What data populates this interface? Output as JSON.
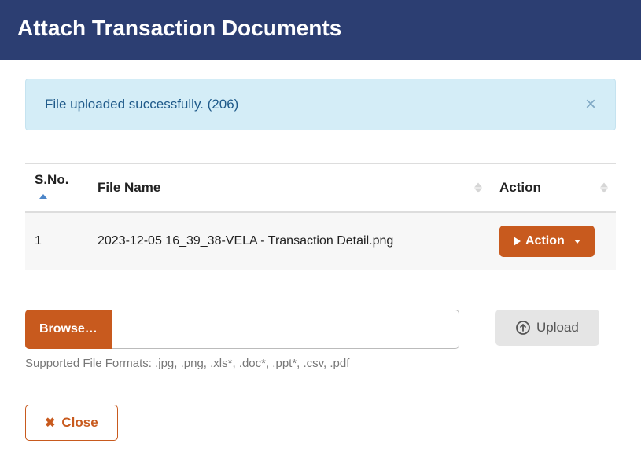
{
  "header": {
    "title": "Attach Transaction Documents"
  },
  "alert": {
    "message": "File uploaded successfully. (206)"
  },
  "table": {
    "headers": {
      "sno": "S.No.",
      "filename": "File Name",
      "action": "Action"
    },
    "rows": [
      {
        "sno": "1",
        "filename": "2023-12-05 16_39_38-VELA - Transaction Detail.png",
        "action_label": "Action"
      }
    ]
  },
  "browse": {
    "label": "Browse…"
  },
  "supported": {
    "text": "Supported File Formats: .jpg, .png, .xls*, .doc*, .ppt*, .csv, .pdf"
  },
  "upload": {
    "label": "Upload"
  },
  "close": {
    "label": "Close"
  },
  "colors": {
    "primary": "#c85a1e",
    "header_bg": "#2c3e72",
    "alert_bg": "#d4edf7"
  }
}
